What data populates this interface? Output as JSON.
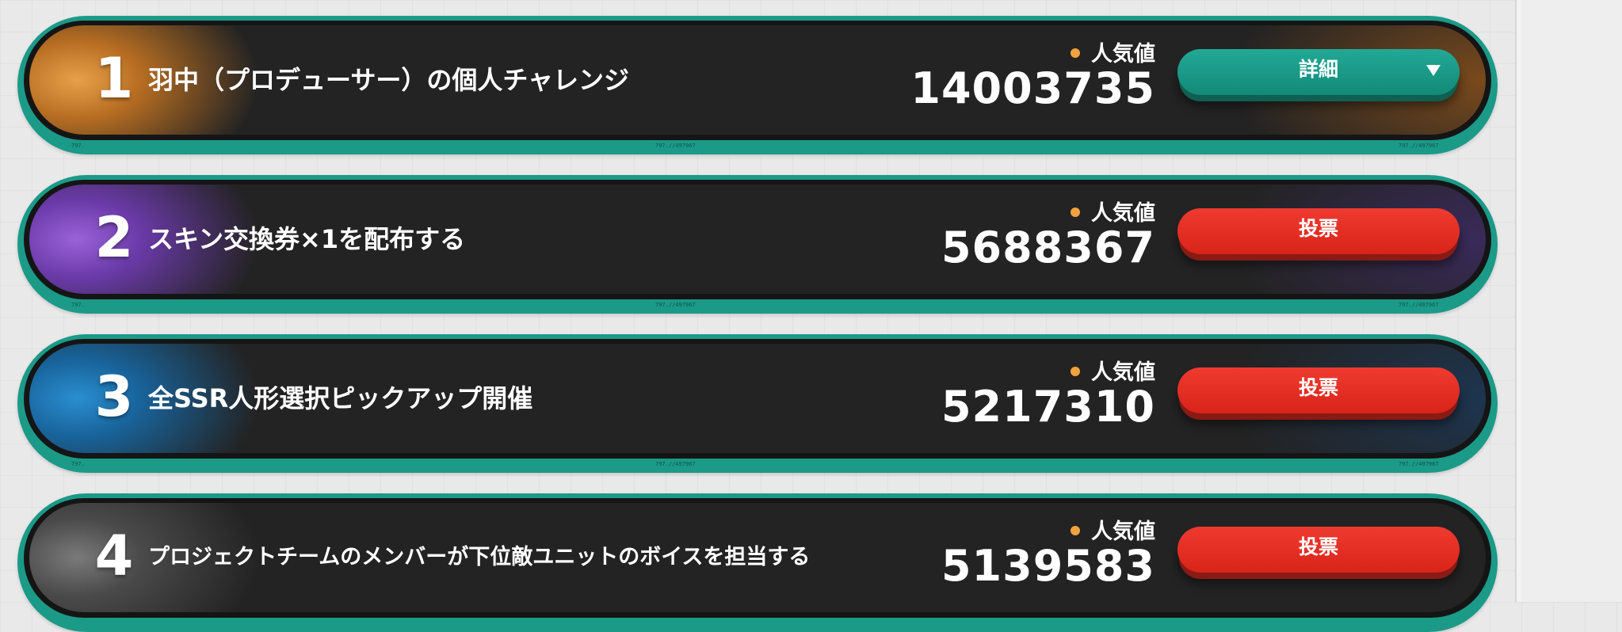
{
  "label_popularity": "人気値",
  "items": [
    {
      "rank": "1",
      "title": "羽中（プロデューサー）の個人チャレンジ",
      "popularity": "14003735",
      "button_label": "詳細",
      "button_style": "teal",
      "has_dropdown": true,
      "accent_color": "#d88a2c",
      "deco_left": "797.",
      "deco_mid": "797.//497967",
      "deco_right": "797.//497967"
    },
    {
      "rank": "2",
      "title": "スキン交換券×1を配布する",
      "popularity": "5688367",
      "button_label": "投票",
      "button_style": "red",
      "has_dropdown": false,
      "accent_color": "#8a55c8",
      "deco_left": "797.",
      "deco_mid": "797.//497967",
      "deco_right": "797.//497967"
    },
    {
      "rank": "3",
      "title": "全SSR人形選択ピックアップ開催",
      "popularity": "5217310",
      "button_label": "投票",
      "button_style": "red",
      "has_dropdown": false,
      "accent_color": "#1e7fc0",
      "deco_left": "797.",
      "deco_mid": "797.//497967",
      "deco_right": "797.//497967"
    },
    {
      "rank": "4",
      "title": "プロジェクトチームのメンバーが下位敵ユニットのボイスを担当する",
      "popularity": "5139583",
      "button_label": "投票",
      "button_style": "red",
      "has_dropdown": false,
      "accent_color": "#6a6a6a"
    }
  ]
}
